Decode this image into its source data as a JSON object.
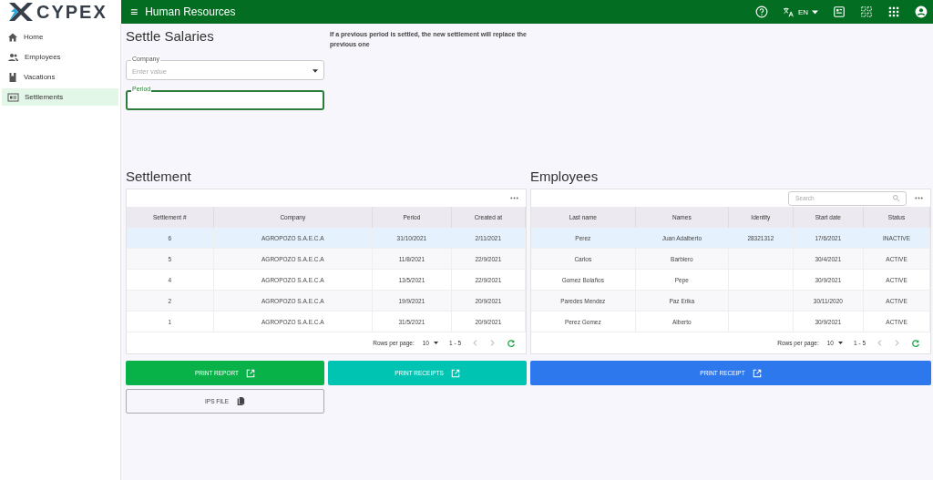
{
  "logo": {
    "text": "CYPEX"
  },
  "topbar": {
    "menu_icon": "≡",
    "title": "Human Resources",
    "language": "EN"
  },
  "sidebar": {
    "items": [
      {
        "label": "Home",
        "kind": "home",
        "selected": false
      },
      {
        "label": "Employees",
        "kind": "people",
        "selected": false
      },
      {
        "label": "Vacations",
        "kind": "book",
        "selected": false
      },
      {
        "label": "Settlements",
        "kind": "card",
        "selected": true
      }
    ]
  },
  "page": {
    "title": "Settle Salaries",
    "notice": "If a previous period is settled, the new settlement will replace the previous one"
  },
  "form": {
    "fields": [
      {
        "label": "Company",
        "placeholder": "Enter value",
        "kind": "select",
        "focused": false
      },
      {
        "label": "Period",
        "kind": "text",
        "focused": true
      }
    ]
  },
  "settlement": {
    "title": "Settlement",
    "columns": [
      "Settlement #",
      "Company",
      "Period",
      "Created at"
    ],
    "rows": [
      {
        "cells": [
          "6",
          "AGROPOZO S.A.E.C.A",
          "31/10/2021",
          "2/11/2021"
        ],
        "selected": true
      },
      {
        "cells": [
          "5",
          "AGROPOZO S.A.E.C.A",
          "11/8/2021",
          "22/9/2021"
        ],
        "selected": false
      },
      {
        "cells": [
          "4",
          "AGROPOZO S.A.E.C.A",
          "13/5/2021",
          "22/9/2021"
        ],
        "selected": false
      },
      {
        "cells": [
          "2",
          "AGROPOZO S.A.E.C.A",
          "19/9/2021",
          "20/9/2021"
        ],
        "selected": false
      },
      {
        "cells": [
          "1",
          "AGROPOZO S.A.E.C.A",
          "31/5/2021",
          "20/9/2021"
        ],
        "selected": false
      }
    ],
    "pagination": {
      "rows_per_page_label": "Rows per page:",
      "rows_per_page": "10",
      "range": "1 - 5"
    }
  },
  "employees": {
    "title": "Employees",
    "search": {
      "placeholder": "Search"
    },
    "columns": [
      "Last name",
      "Names",
      "Identity",
      "Start date",
      "Status"
    ],
    "rows": [
      {
        "cells": [
          "Perez",
          "Juan Adalberto",
          "28321312",
          "17/6/2021",
          "INACTIVE"
        ],
        "selected": true
      },
      {
        "cells": [
          "Carlos",
          "Barbiero",
          "",
          "30/4/2021",
          "ACTIVE"
        ],
        "selected": false
      },
      {
        "cells": [
          "Gomez Bolaños",
          "Pepe",
          "",
          "30/9/2021",
          "ACTIVE"
        ],
        "selected": false
      },
      {
        "cells": [
          "Paredes Mendez",
          "Paz Erika",
          "",
          "30/11/2020",
          "ACTIVE"
        ],
        "selected": false
      },
      {
        "cells": [
          "Perez Gomez",
          "Alberto",
          "",
          "30/9/2021",
          "ACTIVE"
        ],
        "selected": false
      }
    ],
    "pagination": {
      "rows_per_page_label": "Rows per page:",
      "rows_per_page": "10",
      "range": "1 - 5"
    }
  },
  "buttons": [
    {
      "label": "PRINT REPORT",
      "kind": "green"
    },
    {
      "label": "PRINT RECEIPTS",
      "kind": "teal"
    },
    {
      "label": "PRINT RECEIPT",
      "kind": "blue"
    },
    {
      "label": "IPS FILE",
      "kind": "outline"
    }
  ]
}
